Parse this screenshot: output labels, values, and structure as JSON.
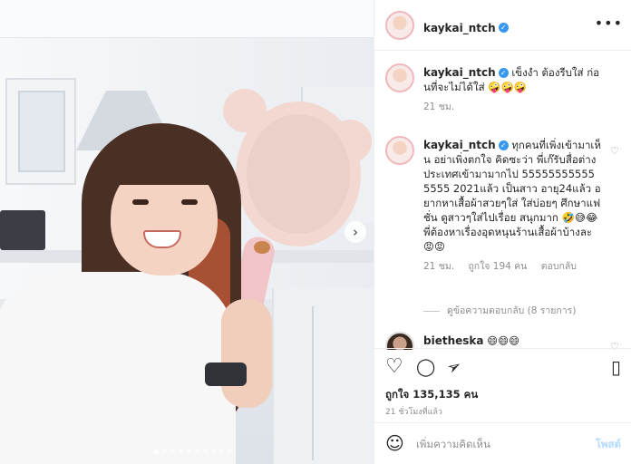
{
  "post": {
    "username": "kaykai_ntch",
    "verified_mark": "✓",
    "more_icon": "more-horizontal-icon"
  },
  "photo": {
    "next_arrow": "›",
    "slide_count": 10,
    "active_slide": 1
  },
  "comments": [
    {
      "username": "kaykai_ntch",
      "text": "เข็งงำ ต้องรีบใส่ ก่อนที่จะไม่ได้ใส่ 🤪🤪🤪",
      "time": "21 ชม."
    },
    {
      "username": "kaykai_ntch",
      "text": "ทุกคนที่เพิ่งเข้ามาเห็น อย่าเพิ่งตกใจ คิดซะว่า พี่เก๊รับสื่อต่างประเทศเข้ามามากไป 555555555555555 2021แล้ว เป็นสาว อายุ24แล้ว อยากหาเสื้อผ้าสวยๆใส่ ใส่บ่อยๆ ศึกษาแฟชั่น ดูสาวๆใส่ไปเรื่อย สนุกมาก 🤣😅😂 พี่ต้องหาเรื่องอุดหนุนร้านเสื้อผ้าบ้างละ 😡😡",
      "time": "21 ชม.",
      "likes": "ถูกใจ 194 คน",
      "reply": "ตอบกลับ",
      "view_replies": "ดูข้อความตอบกลับ (8 รายการ)"
    },
    {
      "username": "bietheska",
      "text": "😄😄😄"
    }
  ],
  "actions": {
    "like_icon": "♡",
    "comment_icon": "◯",
    "share_icon": "➢",
    "save_icon": "▯",
    "likes_text": "ถูกใจ 135,135 คน",
    "time_text": "21 ชั่วโมงที่แล้ว"
  },
  "add_comment": {
    "emoji_icon": "☺",
    "placeholder": "เพิ่มความคิดเห็น",
    "post_label": "โพสต์"
  }
}
